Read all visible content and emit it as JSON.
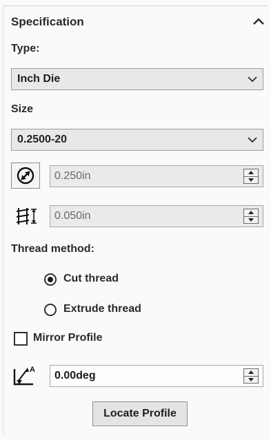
{
  "specification": {
    "title": "Specification",
    "type_label": "Type:",
    "type_value": "Inch Die",
    "size_label": "Size",
    "size_value": "0.2500-20",
    "diameter_value": "0.250in",
    "pitch_value": "0.050in",
    "thread_method_label": "Thread method:",
    "thread_methods": [
      {
        "label": "Cut thread",
        "selected": true
      },
      {
        "label": "Extrude thread",
        "selected": false
      }
    ],
    "mirror_profile_label": "Mirror Profile",
    "mirror_profile_checked": false,
    "angle_value": "0.00deg",
    "locate_profile_label": "Locate Profile"
  },
  "icons": {
    "collapse": "chevron-up-icon",
    "dropdown": "chevron-down-icon",
    "diameter": "diameter-icon",
    "pitch": "thread-pitch-icon",
    "angle": "angle-icon",
    "spinner": "spinner-icon"
  }
}
